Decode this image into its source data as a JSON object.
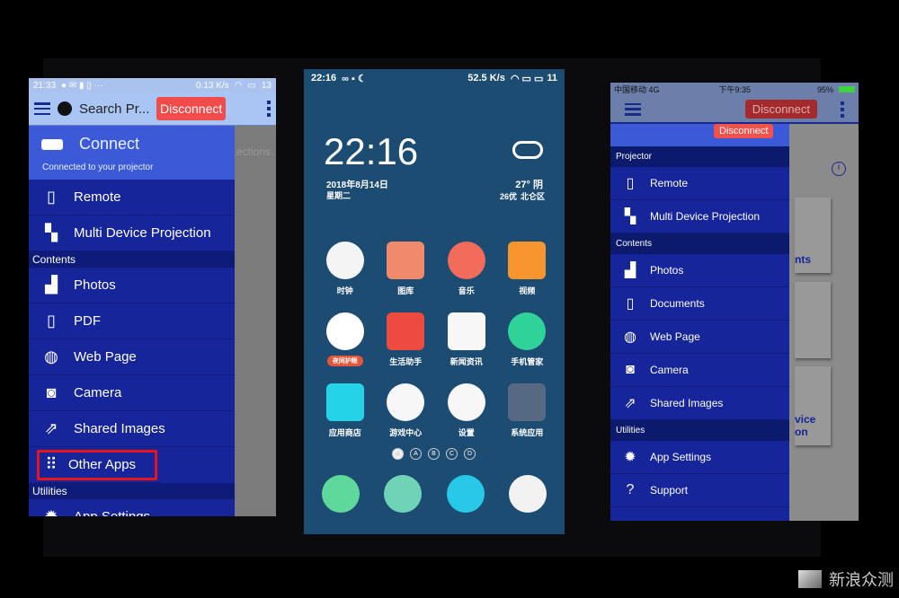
{
  "left_phone": {
    "status": {
      "time": "21:33",
      "network": "0.13 K/s",
      "battery": "13"
    },
    "toolbar": {
      "title": "Search Pr...",
      "disconnect": "Disconnect"
    },
    "drawer_header": {
      "title": "Connect",
      "subtitle": "Connected to your projector"
    },
    "behind_text": "ections.",
    "items": [
      {
        "type": "item",
        "label": "Remote",
        "icon": "remote-icon"
      },
      {
        "type": "item",
        "label": "Multi Device Projection",
        "icon": "multi-device-icon"
      },
      {
        "type": "section",
        "label": "Contents"
      },
      {
        "type": "item",
        "label": "Photos",
        "icon": "photos-icon"
      },
      {
        "type": "item",
        "label": "PDF",
        "icon": "pdf-icon"
      },
      {
        "type": "item",
        "label": "Web Page",
        "icon": "globe-icon"
      },
      {
        "type": "item",
        "label": "Camera",
        "icon": "camera-icon"
      },
      {
        "type": "item",
        "label": "Shared Images",
        "icon": "shared-images-icon"
      },
      {
        "type": "item",
        "label": "Other Apps",
        "icon": "grid-icon",
        "highlighted": true
      },
      {
        "type": "section",
        "label": "Utilities"
      },
      {
        "type": "item",
        "label": "App Settings",
        "icon": "gear-icon"
      }
    ]
  },
  "middle_phone": {
    "status": {
      "time": "22:16",
      "network": "52.5 K/s",
      "battery": "11"
    },
    "clock": "22:16",
    "date": "2018年8月14日",
    "weekday": "星期二",
    "weather": {
      "temp": "27° 阴",
      "aqi": "26优",
      "location": "北仑区"
    },
    "apps": [
      {
        "label": "时钟",
        "color": "#f4f4f4"
      },
      {
        "label": "图库",
        "color": "#f08a6a"
      },
      {
        "label": "音乐",
        "color": "#f26b5b"
      },
      {
        "label": "视频",
        "color": "#f7962e"
      },
      {
        "label": "",
        "badge": "夜间护眼",
        "color": "#ffffff"
      },
      {
        "label": "生活助手",
        "color": "#ef4a3f"
      },
      {
        "label": "新闻资讯",
        "color": "#f7f7f7"
      },
      {
        "label": "手机管家",
        "color": "#2fd39a"
      },
      {
        "label": "应用商店",
        "color": "#25d3e8"
      },
      {
        "label": "游戏中心",
        "color": "#f7f7f7"
      },
      {
        "label": "设置",
        "color": "#f7f7f7"
      },
      {
        "label": "系统应用",
        "color": "#556a82"
      }
    ],
    "page_dots": [
      "⌂",
      "A",
      "B",
      "C",
      "D"
    ]
  },
  "right_phone": {
    "status": {
      "carrier": "中国移动  4G",
      "time": "下午9:35",
      "battery": "95%"
    },
    "toolbar": {
      "disconnect": "Disconnect"
    },
    "drawer_disconnect": "Disconnect",
    "items": [
      {
        "type": "section",
        "label": "Projector"
      },
      {
        "type": "item",
        "label": "Remote",
        "icon": "remote-icon"
      },
      {
        "type": "item",
        "label": "Multi Device Projection",
        "icon": "multi-device-icon"
      },
      {
        "type": "section",
        "label": "Contents"
      },
      {
        "type": "item",
        "label": "Photos",
        "icon": "photos-icon"
      },
      {
        "type": "item",
        "label": "Documents",
        "icon": "document-icon"
      },
      {
        "type": "item",
        "label": "Web Page",
        "icon": "globe-icon"
      },
      {
        "type": "item",
        "label": "Camera",
        "icon": "camera-icon"
      },
      {
        "type": "item",
        "label": "Shared Images",
        "icon": "shared-images-icon"
      },
      {
        "type": "section",
        "label": "Utilities"
      },
      {
        "type": "item",
        "label": "App Settings",
        "icon": "gear-icon"
      },
      {
        "type": "item",
        "label": "Support",
        "icon": "help-icon"
      }
    ],
    "cards": [
      "nts",
      "",
      "vice\non"
    ]
  },
  "watermark": "新浪众测"
}
